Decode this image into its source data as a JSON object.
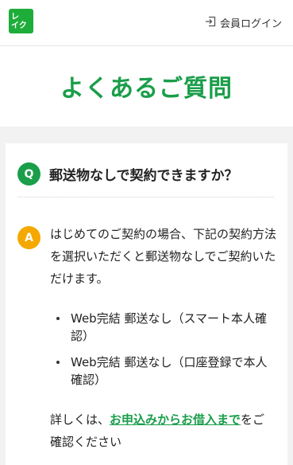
{
  "header": {
    "logo_line1": "レ",
    "logo_line2": "イク",
    "login_label": "会員ログイン",
    "login_icon": "login-icon"
  },
  "page": {
    "title": "よくあるご質問"
  },
  "faq": {
    "q_badge": "Q",
    "question": "郵送物なしで契約できますか？",
    "a_badge": "A",
    "answer_lead": "はじめてのご契約の場合、下記の契約方法を選択いただくと郵送物なしでご契約いただけます。",
    "bullets": [
      "Web完結 郵送なし（スマート本人確認）",
      "Web完結 郵送なし（口座登録で本人確認）"
    ],
    "detail_prefix": "詳しくは、",
    "detail_link": "お申込みからお借入まで",
    "detail_suffix": "をご確認ください"
  },
  "colors": {
    "brand_green": "#1a9e4a",
    "answer_orange": "#f4a800",
    "page_bg": "#f2f2f2"
  }
}
